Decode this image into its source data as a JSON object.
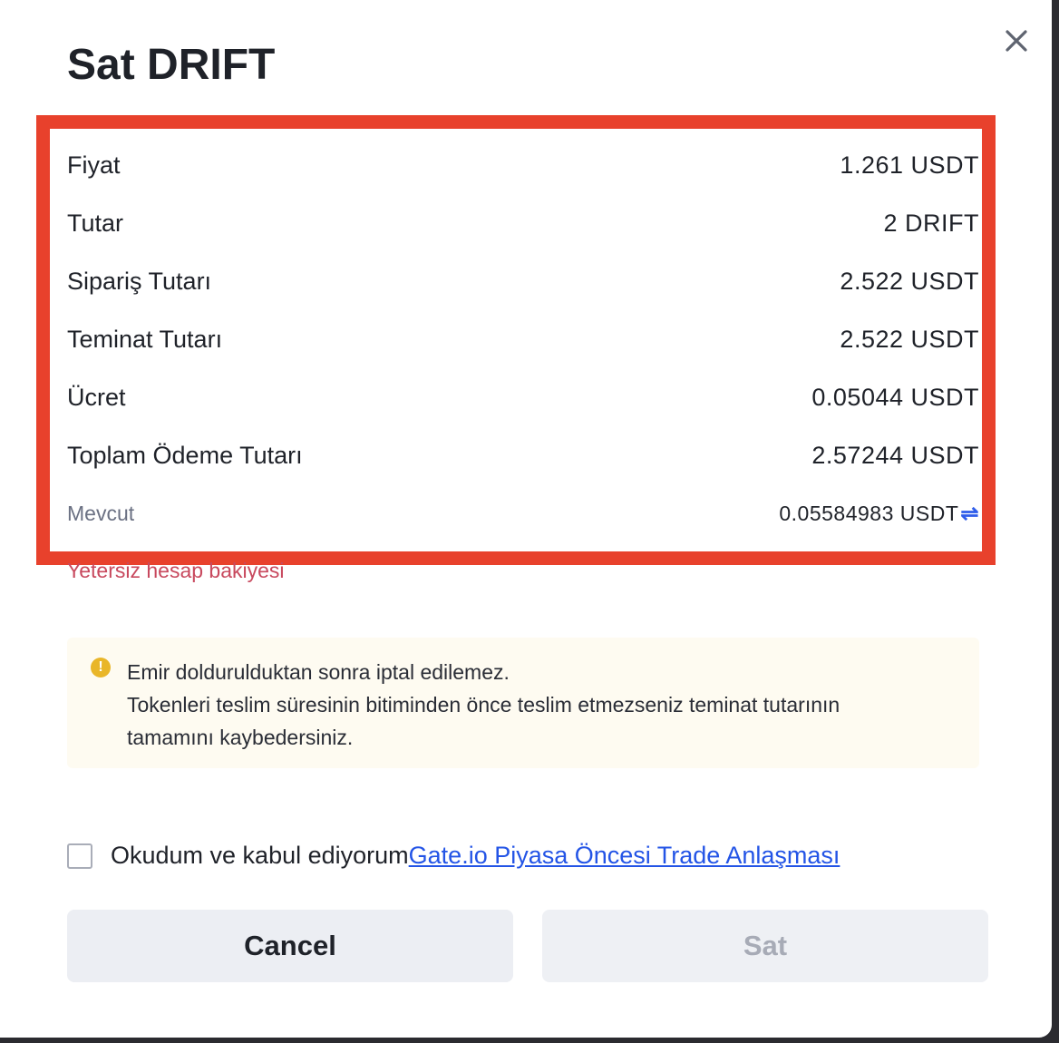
{
  "dialog": {
    "title": "Sat DRIFT",
    "close_icon": "close-icon"
  },
  "summary": {
    "rows": [
      {
        "label": "Fiyat",
        "value": "1.261 USDT"
      },
      {
        "label": "Tutar",
        "value": "2 DRIFT"
      },
      {
        "label": "Sipariş Tutarı",
        "value": "2.522 USDT"
      },
      {
        "label": "Teminat Tutarı",
        "value": "2.522 USDT"
      },
      {
        "label": "Ücret",
        "value": "0.05044 USDT"
      },
      {
        "label": "Toplam Ödeme Tutarı",
        "value": "2.57244 USDT"
      }
    ],
    "available": {
      "label": "Mevcut",
      "value": "0.05584983 USDT",
      "icon": "swap-arrows-icon"
    }
  },
  "error": "Yetersiz hesap bakiyesi",
  "notice": {
    "icon": "warning-icon",
    "line1": "Emir doldurulduktan sonra iptal edilemez.",
    "line2": "Tokenleri teslim süresinin bitiminden önce teslim etmezseniz teminat tutarının",
    "line3": "tamamını kaybedersiniz."
  },
  "agreement": {
    "text": "Okudum ve kabul ediyorum",
    "link": "Gate.io Piyasa Öncesi Trade Anlaşması"
  },
  "buttons": {
    "cancel": "Cancel",
    "sell": "Sat"
  },
  "colors": {
    "highlight_border": "#e8412c",
    "error": "#c8495e",
    "link": "#2354e6",
    "notice_bg": "#fefbf1",
    "warning": "#e9b629"
  }
}
